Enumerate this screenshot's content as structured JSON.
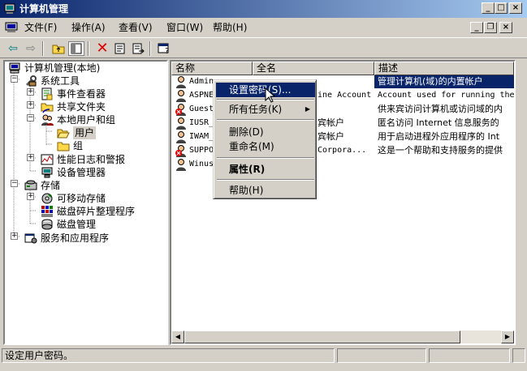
{
  "window": {
    "title": "计算机管理"
  },
  "menu": [
    "文件(F)",
    "操作(A)",
    "查看(V)",
    "窗口(W)",
    "帮助(H)"
  ],
  "tree": {
    "root": "计算机管理(本地)",
    "system_tools": "系统工具",
    "event_viewer": "事件查看器",
    "shared_folders": "共享文件夹",
    "local_users_groups": "本地用户和组",
    "users": "用户",
    "groups": "组",
    "perf_logs": "性能日志和警报",
    "device_manager": "设备管理器",
    "storage": "存储",
    "removable_storage": "可移动存储",
    "defrag": "磁盘碎片整理程序",
    "disk_mgmt": "磁盘管理",
    "services_apps": "服务和应用程序"
  },
  "list": {
    "headers": [
      "名称",
      "全名",
      "描述"
    ],
    "rows": [
      {
        "name": "Admin",
        "fullname": "",
        "desc": "管理计算机(域)的内置帐户"
      },
      {
        "name": "ASPNE",
        "fullname": "ine Account",
        "desc": "Account used for running the"
      },
      {
        "name": "Guest",
        "fullname": "",
        "desc": "供来宾访问计算机或访问域的内"
      },
      {
        "name": "IUSR_",
        "fullname": "宾帐户",
        "desc": "匿名访问 Internet 信息服务的"
      },
      {
        "name": "IWAM_",
        "fullname": "宾帐户",
        "desc": "用于启动进程外应用程序的 Int"
      },
      {
        "name": "SUPPO",
        "fullname": "Corpora...",
        "desc": "这是一个帮助和支持服务的提供"
      },
      {
        "name": "Winus",
        "fullname": "",
        "desc": ""
      }
    ]
  },
  "context_menu": {
    "set_password": "设置密码(S)...",
    "all_tasks": "所有任务(K)",
    "delete": "删除(D)",
    "rename": "重命名(M)",
    "properties": "属性(R)",
    "help": "帮助(H)"
  },
  "status": {
    "text": "设定用户密码。"
  },
  "colors": {
    "title_start": "#0a246a",
    "title_end": "#a6caf0",
    "selection": "#0a246a"
  }
}
